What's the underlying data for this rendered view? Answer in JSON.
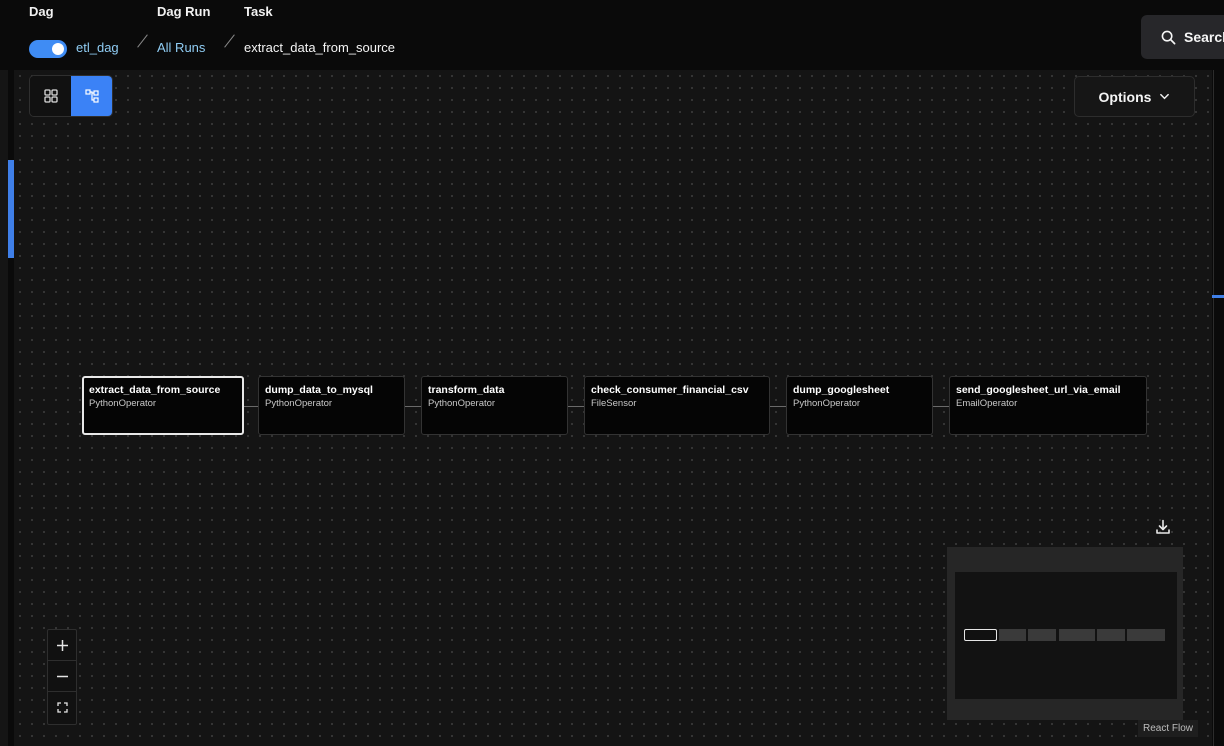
{
  "breadcrumb": {
    "dag": {
      "label": "Dag",
      "value": "etl_dag",
      "paused": false
    },
    "dag_run": {
      "label": "Dag Run",
      "value": "All Runs"
    },
    "task": {
      "label": "Task",
      "value": "extract_data_from_source"
    }
  },
  "search": {
    "label": "Search",
    "icon": "search-icon"
  },
  "view_toggle": {
    "options": [
      {
        "name": "grid",
        "icon": "grid-icon",
        "active": false
      },
      {
        "name": "graph",
        "icon": "graph-icon",
        "active": true
      }
    ]
  },
  "options_button": {
    "label": "Options",
    "icon": "chevron-down-icon"
  },
  "graph": {
    "tasks": [
      {
        "name": "extract_data_from_source",
        "operator": "PythonOperator",
        "selected": true
      },
      {
        "name": "dump_data_to_mysql",
        "operator": "PythonOperator",
        "selected": false
      },
      {
        "name": "transform_data",
        "operator": "PythonOperator",
        "selected": false
      },
      {
        "name": "check_consumer_financial_csv",
        "operator": "FileSensor",
        "selected": false
      },
      {
        "name": "dump_googlesheet",
        "operator": "PythonOperator",
        "selected": false
      },
      {
        "name": "send_googlesheet_url_via_email",
        "operator": "EmailOperator",
        "selected": false
      }
    ]
  },
  "controls": {
    "zoom_in": {
      "label": "+",
      "icon": "plus-icon"
    },
    "zoom_out": {
      "icon": "minus-icon"
    },
    "fit_view": {
      "icon": "fit-view-icon"
    },
    "download": {
      "icon": "download-icon"
    }
  },
  "attribution": "React Flow",
  "colors": {
    "accent": "#3b82f6",
    "link": "#90cdf4",
    "canvas": "#141414",
    "node_bg": "#050505"
  }
}
